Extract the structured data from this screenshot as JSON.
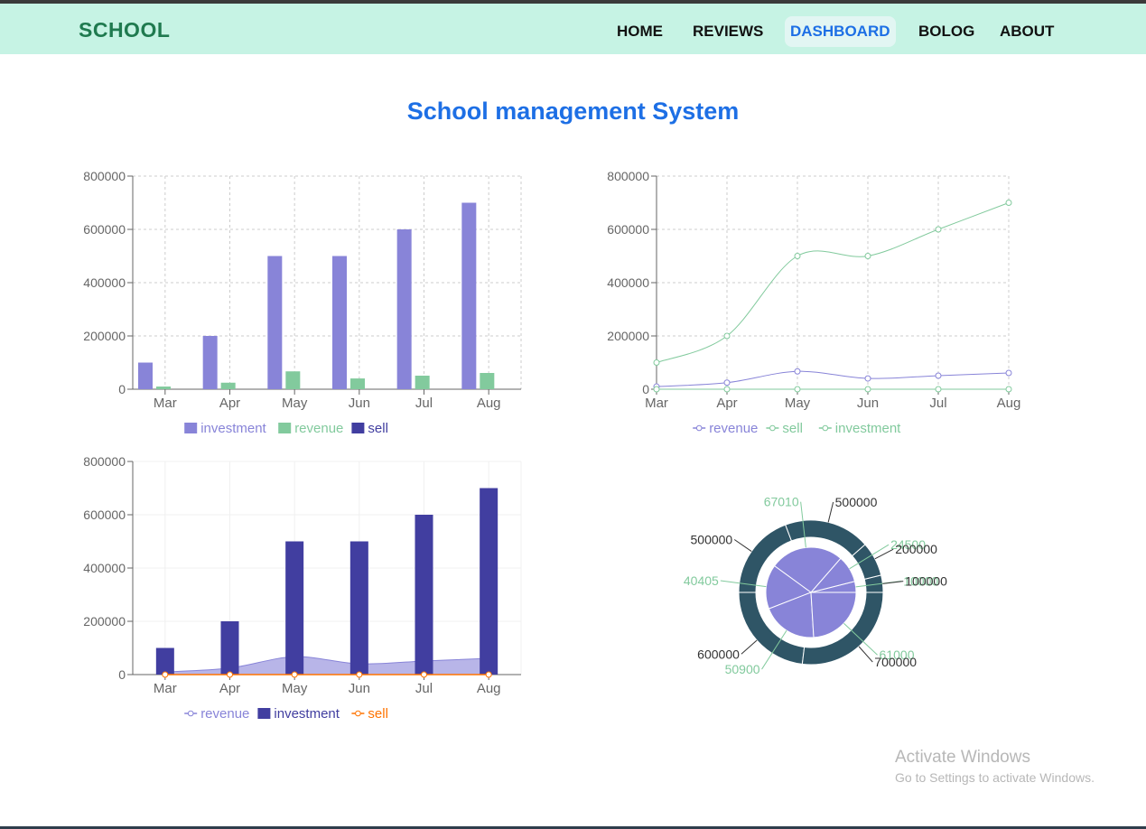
{
  "navbar": {
    "brand": "SCHOOL",
    "items": [
      {
        "label": "HOME",
        "active": false
      },
      {
        "label": "REVIEWS",
        "active": false
      },
      {
        "label": "DASHBOARD",
        "active": true
      },
      {
        "label": "BOLOG",
        "active": false
      },
      {
        "label": "ABOUT",
        "active": false
      }
    ]
  },
  "page": {
    "heading": "School management System"
  },
  "colors": {
    "investment": "#8884d8",
    "revenue": "#82ca9d",
    "sell": "#413ea0",
    "invest_dark": "#413ea0",
    "sell_orange": "#ff7300",
    "pie_outer": "#2f5566"
  },
  "chart_data": [
    {
      "type": "bar",
      "categories": [
        "Mar",
        "Apr",
        "May",
        "Jun",
        "Jul",
        "Aug"
      ],
      "ylim": [
        0,
        800000
      ],
      "yticks": [
        "0",
        "200000",
        "400000",
        "600000",
        "800000"
      ],
      "grid": true,
      "legend": "bottom",
      "series": [
        {
          "name": "investment",
          "values": [
            100000,
            200000,
            500000,
            500000,
            600000,
            700000
          ]
        },
        {
          "name": "revenue",
          "values": [
            10000,
            24500,
            67010,
            40405,
            50900,
            61000
          ]
        },
        {
          "name": "sell",
          "values": [
            0,
            0,
            0,
            0,
            0,
            0
          ]
        }
      ]
    },
    {
      "type": "line",
      "categories": [
        "Mar",
        "Apr",
        "May",
        "Jun",
        "Jul",
        "Aug"
      ],
      "ylim": [
        0,
        800000
      ],
      "yticks": [
        "0",
        "200000",
        "400000",
        "600000",
        "800000"
      ],
      "grid": true,
      "legend": "bottom",
      "series": [
        {
          "name": "revenue",
          "values": [
            10000,
            24500,
            67010,
            40405,
            50900,
            61000
          ]
        },
        {
          "name": "sell",
          "values": [
            0,
            0,
            0,
            0,
            0,
            0
          ]
        },
        {
          "name": "investment",
          "values": [
            100000,
            200000,
            500000,
            500000,
            600000,
            700000
          ]
        }
      ]
    },
    {
      "type": "bar",
      "categories": [
        "Mar",
        "Apr",
        "May",
        "Jun",
        "Jul",
        "Aug"
      ],
      "ylim": [
        0,
        800000
      ],
      "yticks": [
        "0",
        "200000",
        "400000",
        "600000",
        "800000"
      ],
      "grid": true,
      "legend": "bottom",
      "series": [
        {
          "name": "revenue",
          "values": [
            10000,
            24500,
            67010,
            40405,
            50900,
            61000
          ]
        },
        {
          "name": "investment",
          "values": [
            100000,
            200000,
            500000,
            500000,
            600000,
            700000
          ]
        },
        {
          "name": "sell",
          "values": [
            0,
            0,
            0,
            0,
            0,
            0
          ]
        }
      ]
    },
    {
      "type": "pie",
      "inner": {
        "values": [
          10000,
          24500,
          67010,
          40405,
          50900,
          61000
        ],
        "labels": [
          "10000",
          "24500",
          "67010",
          "40405",
          "50900",
          "61000"
        ]
      },
      "outer": {
        "values": [
          100000,
          200000,
          500000,
          500000,
          600000,
          700000
        ],
        "labels": [
          "100000",
          "200000",
          "500000",
          "500000",
          "600000",
          "700000"
        ]
      }
    }
  ],
  "watermark": {
    "title": "Activate Windows",
    "subtitle": "Go to Settings to activate Windows."
  }
}
